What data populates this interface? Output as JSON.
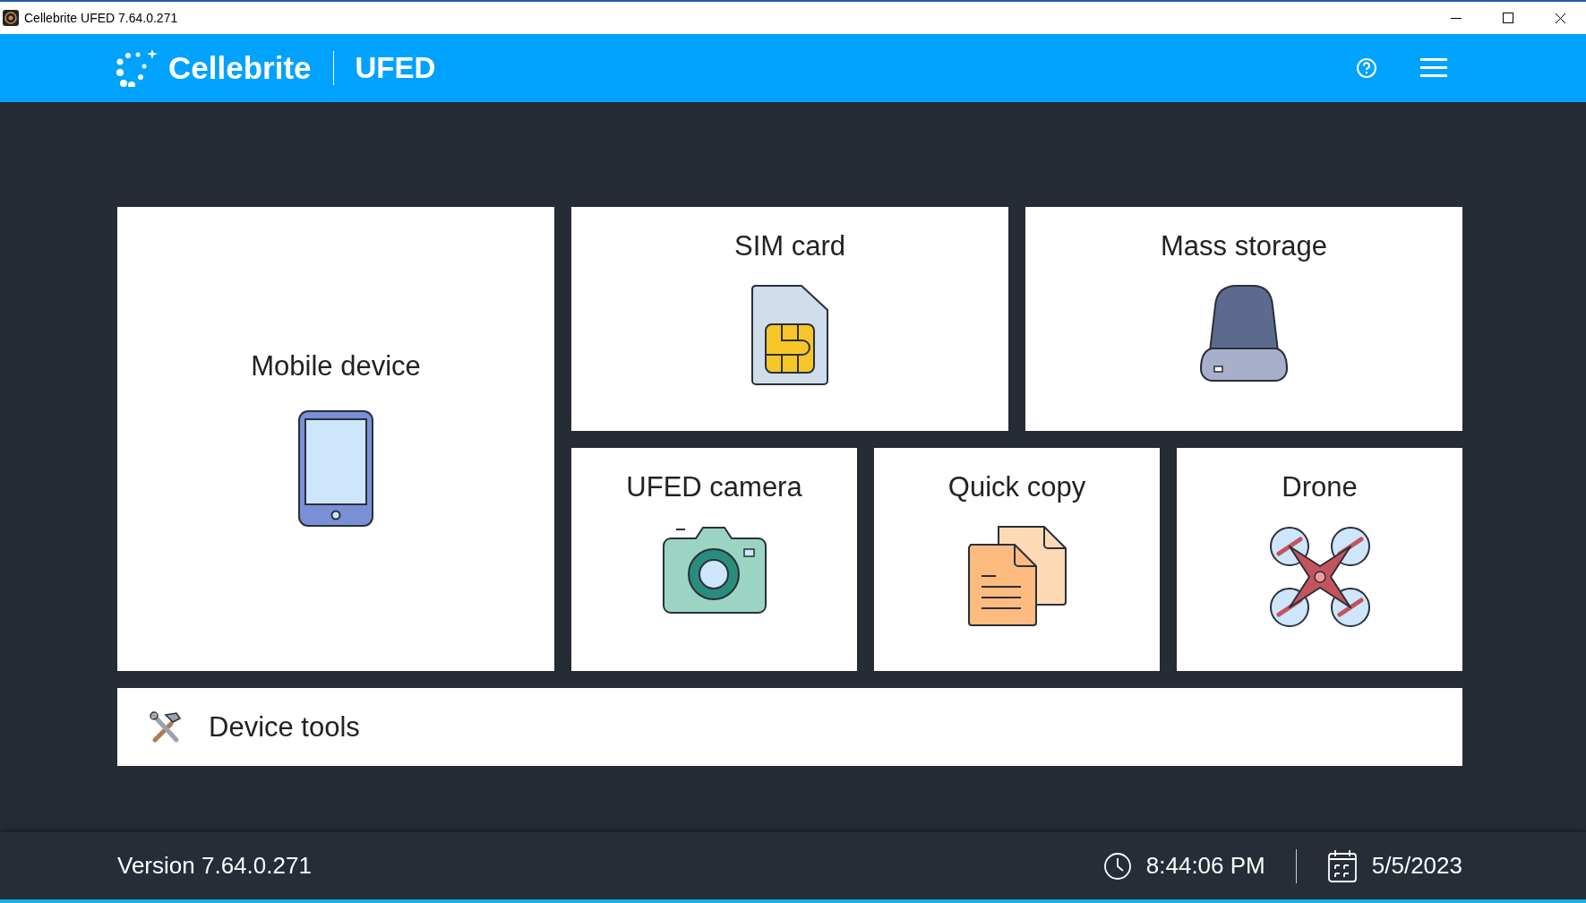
{
  "window": {
    "title": "Cellebrite UFED 7.64.0.271"
  },
  "header": {
    "brand": "Cellebrite",
    "product": "UFED"
  },
  "tiles": [
    {
      "label": "Mobile device",
      "kind": "phone"
    },
    {
      "label": "SIM card",
      "kind": "sim"
    },
    {
      "label": "Mass storage",
      "kind": "storage"
    },
    {
      "label": "UFED camera",
      "kind": "camera"
    },
    {
      "label": "Quick copy",
      "kind": "copy"
    },
    {
      "label": "Drone",
      "kind": "drone"
    }
  ],
  "device_tools": {
    "label": "Device tools"
  },
  "status_bar": {
    "version": "Version 7.64.0.271",
    "time": "8:44:06 PM",
    "date": "5/5/2023"
  }
}
